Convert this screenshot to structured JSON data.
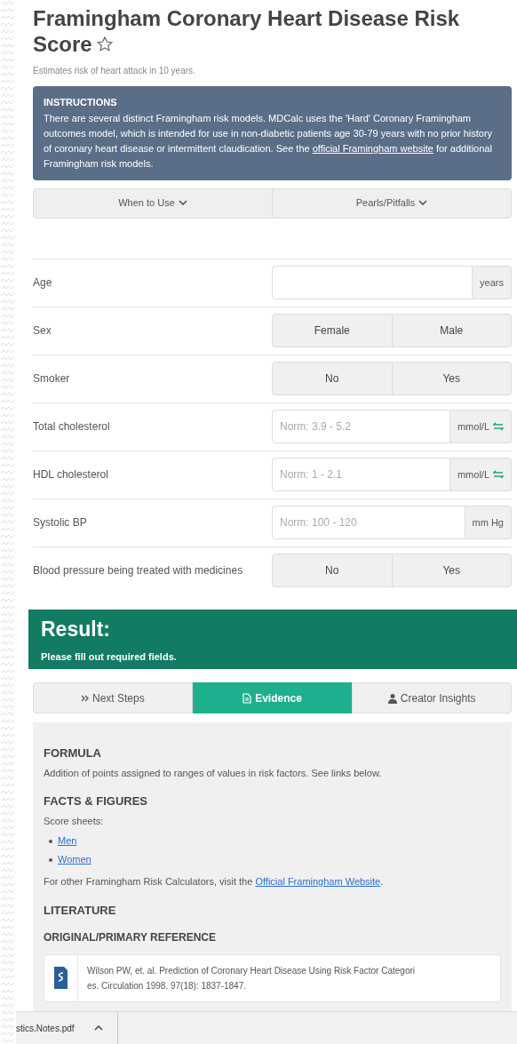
{
  "header": {
    "title": "Framingham Coronary Heart Disease Risk Score",
    "favorite": false,
    "subtitle": "Estimates risk of heart attack in 10 years."
  },
  "instructions": {
    "heading": "INSTRUCTIONS",
    "text_before": "There are several distinct Framingham risk models. MDCalc uses the 'Hard' Coronary Framingham outcomes model, which is intended for use in non-diabetic patients age 30-79 years with no prior history of coronary heart disease or intermittent claudication. See the",
    "link": "official Framingham website",
    "text_after": "for additional Framingham risk models."
  },
  "info_buttons": [
    {
      "label": "When to Use"
    },
    {
      "label": "Pearls/Pitfalls"
    }
  ],
  "fields": [
    {
      "kind": "number",
      "label": "Age",
      "unit": "years",
      "convertible": false
    },
    {
      "kind": "choice",
      "label": "Sex",
      "options": [
        {
          "label": "Female",
          "selected": false
        },
        {
          "label": "Male",
          "selected": false
        }
      ]
    },
    {
      "kind": "choice",
      "label": "Smoker",
      "options": [
        {
          "label": "No",
          "selected": false
        },
        {
          "label": "Yes",
          "selected": false
        }
      ]
    },
    {
      "kind": "number",
      "label": "Total cholesterol",
      "placeholder": "Norm: 3.9 - 5.2",
      "unit": "mmol/L",
      "convertible": true
    },
    {
      "kind": "number",
      "label": "HDL cholesterol",
      "placeholder": "Norm: 1 - 2.1",
      "unit": "mmol/L",
      "convertible": true
    },
    {
      "kind": "number",
      "label": "Systolic BP",
      "placeholder": "Norm: 100 - 120",
      "unit": "mm Hg",
      "convertible": false
    },
    {
      "kind": "choice",
      "label": "Blood pressure being treated with medicines",
      "options": [
        {
          "label": "No",
          "selected": false
        },
        {
          "label": "Yes",
          "selected": false
        }
      ]
    }
  ],
  "result": {
    "title": "Result:",
    "message": "Please fill out required fields."
  },
  "tabs": [
    {
      "label": "Next Steps",
      "selected": false
    },
    {
      "label": "Evidence",
      "selected": true
    },
    {
      "label": "Creator Insights",
      "selected": false
    }
  ],
  "evidence": {
    "formula_heading": "FORMULA",
    "formula_text": "Addition of points assigned to ranges of values in risk factors. See links below.",
    "facts_heading": "FACTS & FIGURES",
    "score_sheets_label": "Score sheets:",
    "score_sheets": [
      "Men",
      "Women"
    ],
    "other_before": "For other Framingham Risk Calculators, visit the",
    "other_link": "Official Framingham Website",
    "other_after": ".",
    "literature_heading": "LITERATURE",
    "reference_heading": "ORIGINAL/PRIMARY REFERENCE",
    "reference_lines": [
      "Wilson PW, et. al. Prediction of Coronary Heart Disease Using Risk Factor Categori",
      "es. Circulation 1998. 97(18): 1837-1847."
    ]
  },
  "download_bar": {
    "file": "stics.Notes.pdf"
  }
}
